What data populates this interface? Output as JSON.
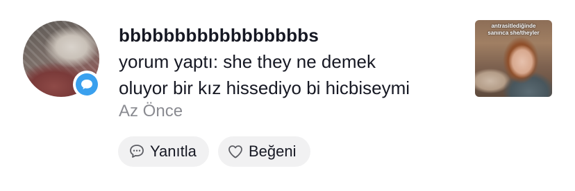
{
  "notification": {
    "username": "bbbbbbbbbbbbbbbbbs",
    "comment_line1": "yorum yaptı: she they ne demek",
    "comment_line2": "oluyor bir kız hissediyo bi hicbiseymi",
    "time": "Az Önce",
    "reply_label": "Yanıtla",
    "like_label": "Beğeni",
    "thumbnail_caption_line1": "antrasitlediğinde",
    "thumbnail_caption_line2": "sanınca she/theyler",
    "badge_icon": "comment-bubble-icon",
    "badge_color": "#3aa0ee"
  }
}
